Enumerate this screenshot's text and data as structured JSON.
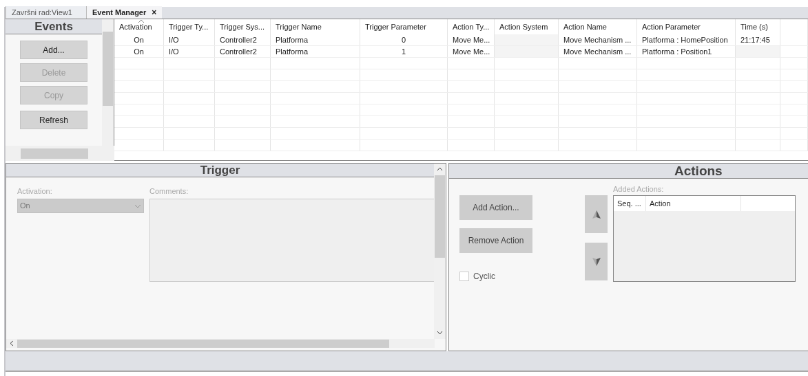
{
  "tabs": [
    {
      "label": "Završni rad:View1",
      "selected": false
    },
    {
      "label": "Event Manager",
      "selected": true,
      "close": "×"
    }
  ],
  "events": {
    "title": "Events",
    "buttons": [
      {
        "label": "Add...",
        "disabled": false
      },
      {
        "label": "Delete",
        "disabled": true
      },
      {
        "label": "Copy",
        "disabled": true
      },
      {
        "label": "Refresh",
        "disabled": false
      }
    ]
  },
  "table": {
    "columns": [
      {
        "label": "Activation",
        "sorted": true
      },
      {
        "label": "Trigger Ty...",
        "sorted": false
      },
      {
        "label": "Trigger Sys...",
        "sorted": false
      },
      {
        "label": "Trigger Name",
        "sorted": false
      },
      {
        "label": "Trigger Parameter",
        "sorted": false
      },
      {
        "label": "Action Ty...",
        "sorted": false
      },
      {
        "label": "Action System",
        "sorted": false
      },
      {
        "label": "Action Name",
        "sorted": false
      },
      {
        "label": "Action Parameter",
        "sorted": false
      },
      {
        "label": "Time (s)",
        "sorted": false
      }
    ],
    "rows": [
      [
        "On",
        "I/O",
        "Controller2",
        "Platforma",
        "0",
        "Move Me...",
        null,
        "Move Mechanism ...",
        "Platforma : HomePosition",
        "21:17:45"
      ],
      [
        "On",
        "I/O",
        "Controller2",
        "Platforma",
        "1",
        "Move Me...",
        null,
        "Move Mechanism ...",
        "Platforma : Position1",
        null
      ]
    ]
  },
  "trigger": {
    "title": "Trigger",
    "activation_label": "Activation:",
    "activation_value": "On",
    "comments_label": "Comments:"
  },
  "actions": {
    "title": "Actions",
    "buttons": [
      "Add Action...",
      "Remove Action"
    ],
    "cyclic": {
      "label": "Cyclic",
      "checked": false
    },
    "added_actions_label": "Added Actions:",
    "list_columns": [
      "Seq. ...",
      "Action"
    ]
  }
}
